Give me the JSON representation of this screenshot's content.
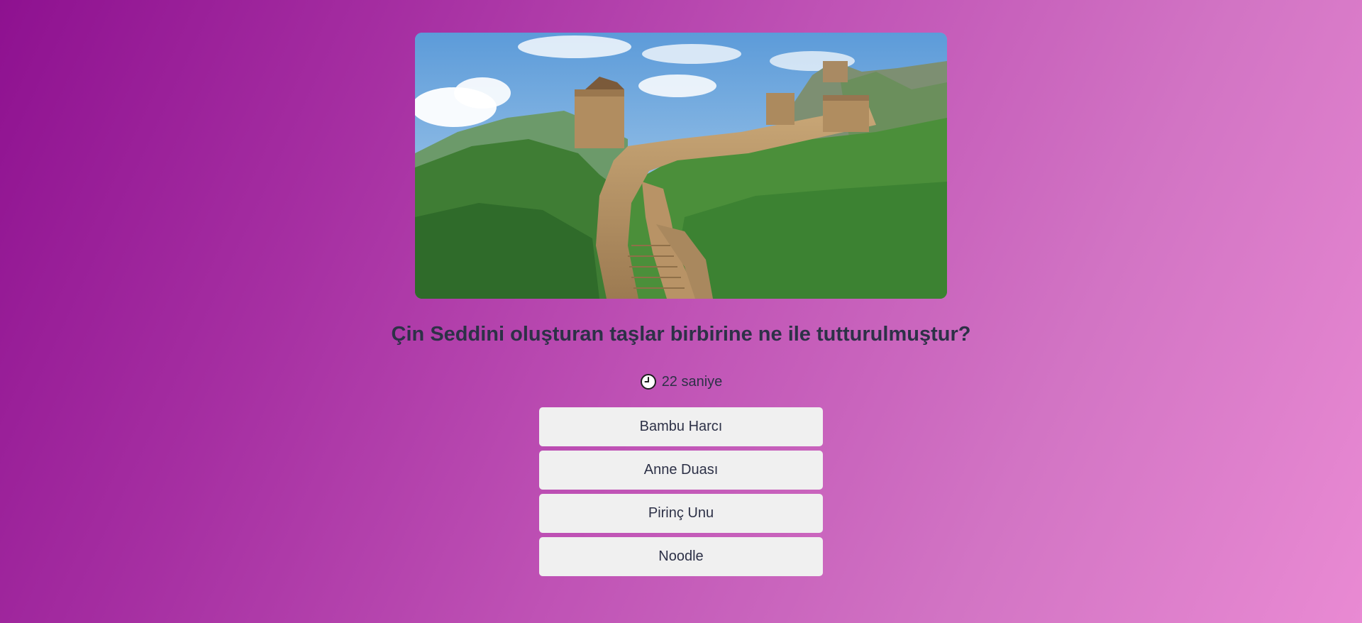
{
  "quiz": {
    "image": {
      "subject": "great-wall-of-china"
    },
    "question": "Çin Seddini oluşturan taşlar birbirine ne ile tutturulmuştur?",
    "timer": {
      "icon": "clock-icon",
      "text": "22 saniye"
    },
    "options": [
      {
        "label": "Bambu Harcı"
      },
      {
        "label": "Anne Duası"
      },
      {
        "label": "Pirinç Unu"
      },
      {
        "label": "Noodle"
      }
    ]
  },
  "colors": {
    "background_start": "#8e1190",
    "background_end": "#e98ad3",
    "text": "#2d3147",
    "option_bg": "#f0f0f0"
  }
}
